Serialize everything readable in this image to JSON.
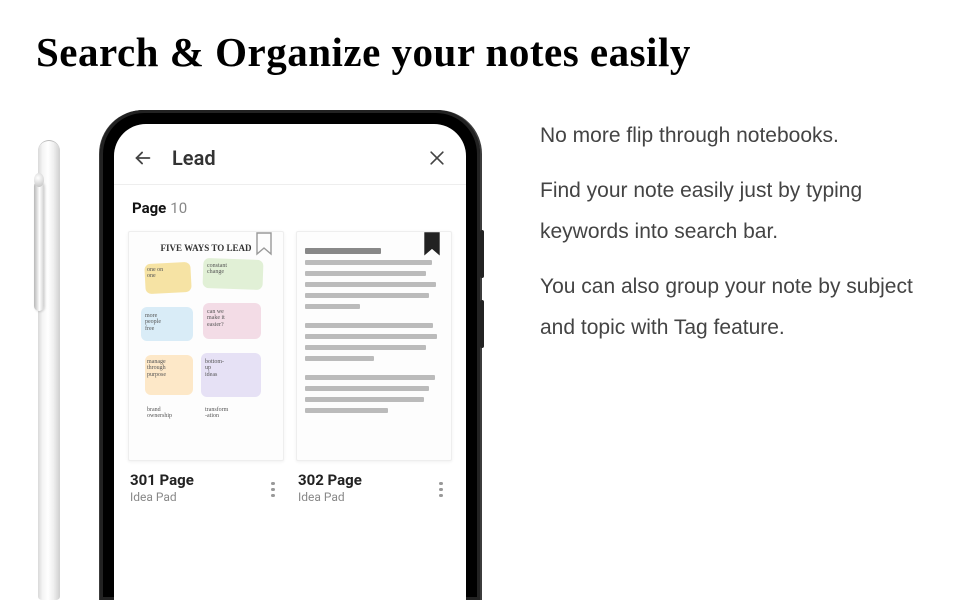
{
  "heading": "Search & Organize your notes easily",
  "copy": {
    "p1": "No more flip through notebooks.",
    "p2": "Find your note easily just by typing keywords into search bar.",
    "p3": "You can also group your note by subject and topic with Tag feature."
  },
  "app": {
    "search_query": "Lead",
    "page_label": "Page",
    "page_count": "10",
    "results": {
      "0": {
        "title": "301 Page",
        "subtitle": "Idea Pad",
        "sketch_heading": "FIVE WAYS TO LEAD",
        "bookmarked": false
      },
      "1": {
        "title": "302 Page",
        "subtitle": "Idea Pad",
        "bookmarked": true
      }
    }
  }
}
